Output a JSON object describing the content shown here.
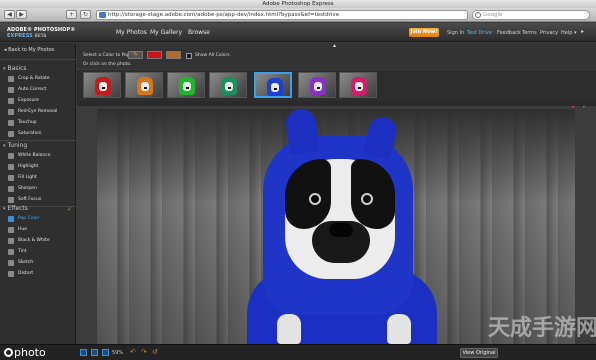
{
  "window": {
    "title": "Adobe Photoshop Express"
  },
  "browser": {
    "url": "http://storage-stage.adobe.com/adobe-ps/app-dev/index.html?bypass&ef=testdrive",
    "search_placeholder": "Google",
    "back": "◀",
    "forward": "▶",
    "add": "+",
    "reload": "↻"
  },
  "app": {
    "logo_line1": "ADOBE® PHOTOSHOP®",
    "logo_line2": "EXPRESS",
    "logo_badge": "BETA",
    "nav": {
      "my_photos": "My Photos",
      "my_gallery": "My Gallery",
      "browse": "Browse"
    },
    "join_label": "Join Now!",
    "links": {
      "sign_in": "Sign In",
      "test_drive": "Test Drive",
      "feedback": "Feedback",
      "terms": "Terms",
      "privacy": "Privacy",
      "help": "Help ▾"
    }
  },
  "sidebar": {
    "back_label": "◂ Back to My Photos",
    "sections": [
      {
        "label": "Basics",
        "items": [
          "Crop & Rotate",
          "Auto Correct",
          "Exposure",
          "Red-Eye Removal",
          "Touchup",
          "Saturation"
        ]
      },
      {
        "label": "Tuning",
        "items": [
          "White Balance",
          "Highlight",
          "Fill Light",
          "Sharpen",
          "Soft Focus"
        ]
      },
      {
        "label": "Effects",
        "items": [
          "Pop Color",
          "Hue",
          "Black & White",
          "Tint",
          "Sketch",
          "Distort"
        ]
      }
    ],
    "active_item": "Pop Color"
  },
  "controls": {
    "select_color_label": "Select a Color to Pop:",
    "show_all_label": "Show All Colors",
    "instruction": "Or click on the photo."
  },
  "thumbnails": {
    "colors": [
      "#c61b1b",
      "#d2771f",
      "#1fb52c",
      "#1e8f5a",
      "#1f3fcf",
      "#8a2fc8",
      "#d01f6a"
    ],
    "selected_index": 4
  },
  "status": {
    "zoom": "59%",
    "view_original": "View Original",
    "logo_text": "photo",
    "watermark": "天成手游网"
  },
  "colors": {
    "accent": "#3aa0ee",
    "join": "#f0951f",
    "hood": "#1f35c8"
  }
}
